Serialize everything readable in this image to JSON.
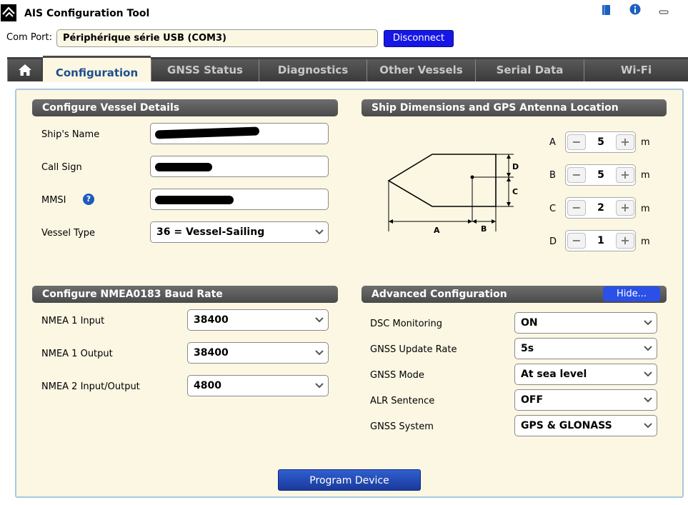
{
  "window": {
    "title": "AIS Configuration Tool",
    "buttons": [
      {
        "name": "book-icon",
        "glyph": "▮",
        "color": "#1f5fbf"
      },
      {
        "name": "info-icon",
        "glyph": "i",
        "color": "#1f5fbf"
      },
      {
        "name": "minimize-icon",
        "glyph": "▬",
        "color": "#777777"
      }
    ]
  },
  "comport": {
    "label": "Com Port:",
    "value": "Périphérique série USB (COM3)",
    "disconnect_label": "Disconnect"
  },
  "tabs": [
    "Configuration",
    "GNSS Status",
    "Diagnostics",
    "Other Vessels",
    "Serial Data",
    "Wi-Fi"
  ],
  "vessel": {
    "header": "Configure Vessel Details",
    "name_label": "Ship's Name",
    "callsign_label": "Call Sign",
    "mmsi_label": "MMSI",
    "type_label": "Vessel Type",
    "type_value": "36 = Vessel-Sailing"
  },
  "dimensions": {
    "header": "Ship Dimensions and GPS Antenna Location",
    "rows": [
      {
        "letter": "A",
        "value": "5",
        "unit": "m"
      },
      {
        "letter": "B",
        "value": "5",
        "unit": "m"
      },
      {
        "letter": "C",
        "value": "2",
        "unit": "m"
      },
      {
        "letter": "D",
        "value": "1",
        "unit": "m"
      }
    ],
    "diagram_labels": {
      "a": "A",
      "b": "B",
      "c": "C",
      "d": "D"
    }
  },
  "nmea": {
    "header": "Configure NMEA0183 Baud Rate",
    "rows": [
      {
        "label": "NMEA 1 Input",
        "value": "38400"
      },
      {
        "label": "NMEA 1 Output",
        "value": "38400"
      },
      {
        "label": "NMEA 2 Input/Output",
        "value": "4800"
      }
    ]
  },
  "advanced": {
    "header": "Advanced Configuration",
    "hide_label": "Hide...",
    "rows": [
      {
        "label": "DSC Monitoring",
        "value": "ON"
      },
      {
        "label": "GNSS Update Rate",
        "value": "5s"
      },
      {
        "label": "GNSS Mode",
        "value": "At sea level"
      },
      {
        "label": "ALR Sentence",
        "value": "OFF"
      },
      {
        "label": "GNSS System",
        "value": "GPS & GLONASS"
      }
    ]
  },
  "program_label": "Program Device",
  "stepper": {
    "minus": "−",
    "plus": "+"
  },
  "help_glyph": "?"
}
